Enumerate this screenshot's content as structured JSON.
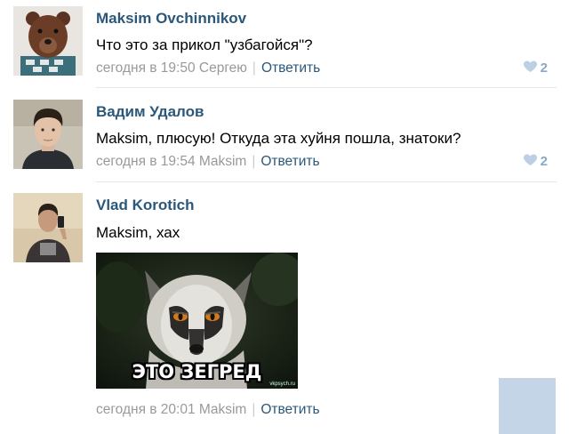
{
  "comments": [
    {
      "author": "Maksim Ovchinnikov",
      "text": "Что это за прикол \"узбагойся\"?",
      "time": "сегодня в 19:50",
      "to": "Сергею",
      "reply": "Ответить",
      "likes": "2",
      "avatar": "bear-avatar"
    },
    {
      "author": "Вадим Удалов",
      "text": "Maksim, плюсую! Откуда эта хуйня пошла, знатоки?",
      "time": "сегодня в 19:54",
      "to": "Maksim",
      "reply": "Ответить",
      "likes": "2",
      "avatar": "young-man-avatar"
    },
    {
      "author": "Vlad Korotich",
      "text": "Maksim, хах",
      "time": "сегодня в 20:01",
      "to": "Maksim",
      "reply": "Ответить",
      "avatar": "mirror-selfie-avatar",
      "image": {
        "subject": "lemur meme",
        "caption": "ЭТО ЗЕГРЕД",
        "watermark": "vkpsych.ru"
      }
    }
  ],
  "colors": {
    "link": "#2b587a",
    "meta": "#999999",
    "like": "#8aa8c8",
    "divider": "#e4e8ec"
  },
  "icons": {
    "like": "heart-icon"
  }
}
